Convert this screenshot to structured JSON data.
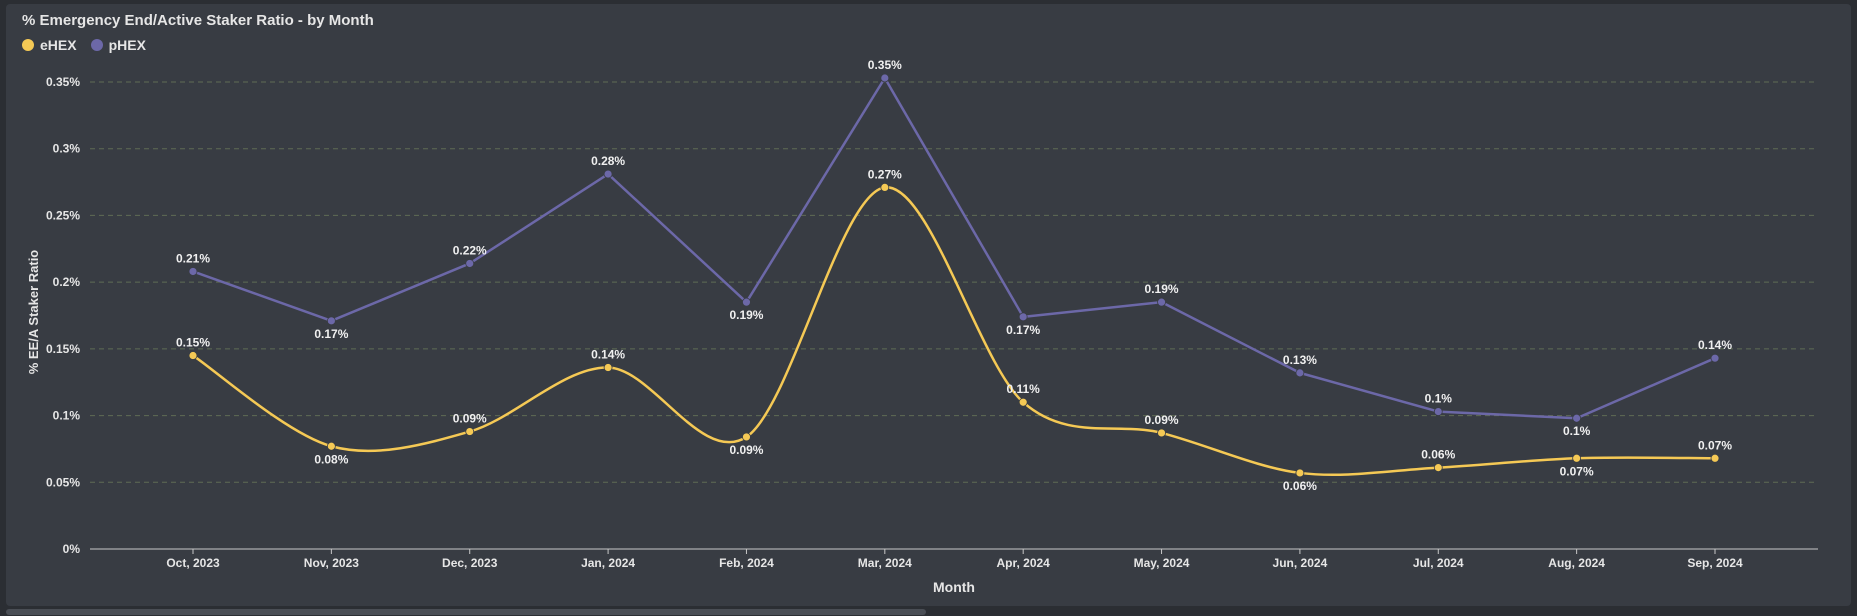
{
  "chart_data": {
    "type": "line",
    "title": "% Emergency End/Active Staker Ratio - by Month",
    "xlabel": "Month",
    "ylabel": "% EE/A Staker Ratio",
    "ylim": [
      0,
      0.35
    ],
    "yticks": [
      "0%",
      "0.05%",
      "0.1%",
      "0.15%",
      "0.2%",
      "0.25%",
      "0.3%",
      "0.35%"
    ],
    "categories": [
      "Oct, 2023",
      "Nov, 2023",
      "Dec, 2023",
      "Jan, 2024",
      "Feb, 2024",
      "Mar, 2024",
      "Apr, 2024",
      "May, 2024",
      "Jun, 2024",
      "Jul, 2024",
      "Aug, 2024",
      "Sep, 2024"
    ],
    "series": [
      {
        "name": "eHEX",
        "color": "#f5c955",
        "values": [
          0.145,
          0.077,
          0.088,
          0.136,
          0.084,
          0.271,
          0.11,
          0.087,
          0.057,
          0.061,
          0.068,
          0.068
        ],
        "labels": [
          "0.15%",
          "0.08%",
          "0.09%",
          "0.14%",
          "0.09%",
          "0.27%",
          "0.11%",
          "0.09%",
          "0.06%",
          "0.06%",
          "0.07%",
          "0.07%"
        ],
        "label_pos": [
          "above",
          "below",
          "above",
          "above",
          "below",
          "above",
          "above",
          "above",
          "below",
          "above",
          "below",
          "above"
        ]
      },
      {
        "name": "pHEX",
        "color": "#6c68a8",
        "values": [
          0.208,
          0.171,
          0.214,
          0.281,
          0.185,
          0.353,
          0.174,
          0.185,
          0.132,
          0.103,
          0.098,
          0.143
        ],
        "labels": [
          "0.21%",
          "0.17%",
          "0.22%",
          "0.28%",
          "0.19%",
          "0.35%",
          "0.17%",
          "0.19%",
          "0.13%",
          "0.1%",
          "0.1%",
          "0.14%"
        ],
        "label_pos": [
          "above",
          "below",
          "above",
          "above",
          "below",
          "above",
          "below",
          "above",
          "above",
          "above",
          "below",
          "above"
        ]
      }
    ],
    "grid": true,
    "legend_position": "top-left"
  }
}
